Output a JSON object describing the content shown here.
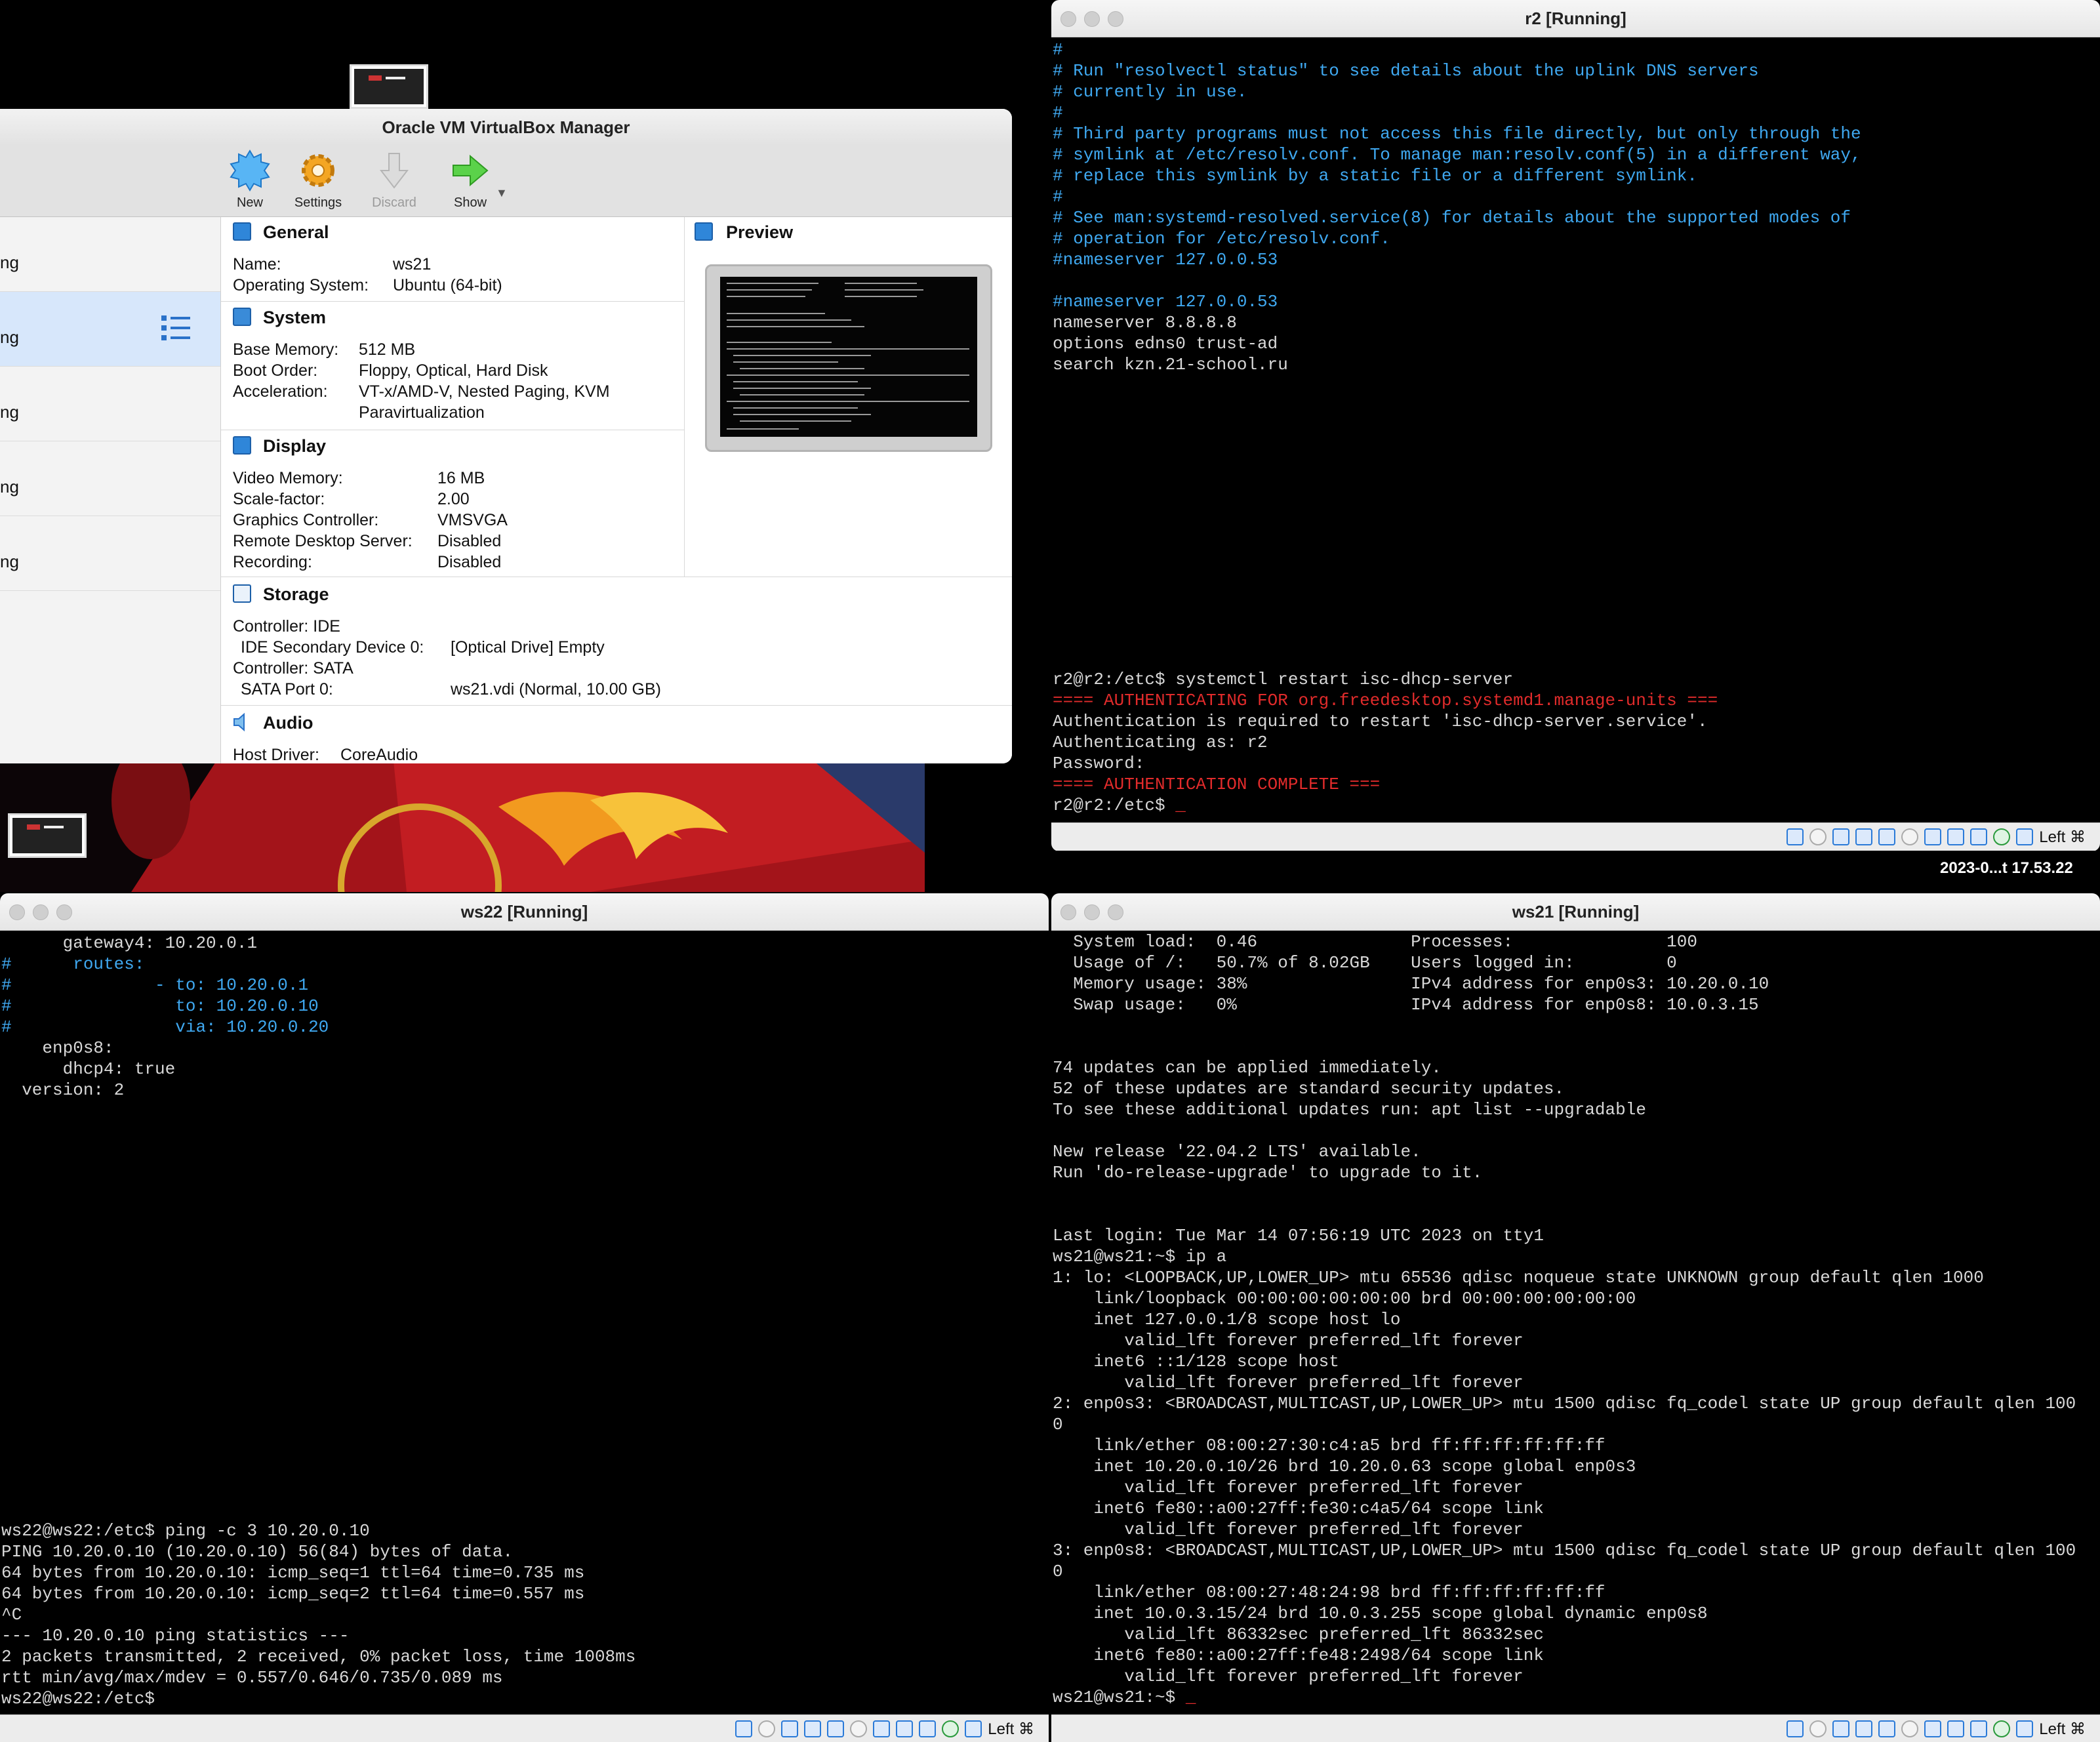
{
  "desktop": {
    "datetime": "2023-0...t 17.53.22"
  },
  "vbox": {
    "title": "Oracle VM VirtualBox Manager",
    "toolbar": {
      "new": "New",
      "settings": "Settings",
      "discard": "Discard",
      "show": "Show"
    },
    "vm_list": [
      "ng",
      "ng",
      "ng",
      "ng",
      "ng"
    ],
    "general": {
      "heading": "General",
      "name_label": "Name:",
      "name": "ws21",
      "os_label": "Operating System:",
      "os": "Ubuntu (64-bit)"
    },
    "system": {
      "heading": "System",
      "mem_label": "Base Memory:",
      "mem": "512 MB",
      "boot_label": "Boot Order:",
      "boot": "Floppy, Optical, Hard Disk",
      "accel_label": "Acceleration:",
      "accel1": "VT-x/AMD-V, Nested Paging, KVM",
      "accel2": "Paravirtualization"
    },
    "preview": {
      "heading": "Preview"
    },
    "display": {
      "heading": "Display",
      "vmem_label": "Video Memory:",
      "vmem": "16 MB",
      "scale_label": "Scale-factor:",
      "scale": "2.00",
      "gc_label": "Graphics Controller:",
      "gc": "VMSVGA",
      "rds_label": "Remote Desktop Server:",
      "rds": "Disabled",
      "rec_label": "Recording:",
      "rec": "Disabled"
    },
    "storage": {
      "heading": "Storage",
      "ctrl_ide": "Controller: IDE",
      "ide_dev_label": "IDE Secondary Device 0:",
      "ide_dev": "[Optical Drive] Empty",
      "ctrl_sata": "Controller: SATA",
      "sata_label": "SATA Port 0:",
      "sata": "ws21.vdi (Normal, 10.00 GB)"
    },
    "audio": {
      "heading": "Audio",
      "driver_label": "Host Driver:",
      "driver": "CoreAudio"
    }
  },
  "r2": {
    "title": "r2 [Running]",
    "status_key": "Left ⌘",
    "lines": [
      {
        "t": "#",
        "c": "blue"
      },
      {
        "t": "# Run \"resolvectl status\" to see details about the uplink DNS servers",
        "c": "blue"
      },
      {
        "t": "# currently in use.",
        "c": "blue"
      },
      {
        "t": "#",
        "c": "blue"
      },
      {
        "t": "# Third party programs must not access this file directly, but only through the",
        "c": "blue"
      },
      {
        "t": "# symlink at /etc/resolv.conf. To manage man:resolv.conf(5) in a different way,",
        "c": "blue"
      },
      {
        "t": "# replace this symlink by a static file or a different symlink.",
        "c": "blue"
      },
      {
        "t": "#",
        "c": "blue"
      },
      {
        "t": "# See man:systemd-resolved.service(8) for details about the supported modes of",
        "c": "blue"
      },
      {
        "t": "# operation for /etc/resolv.conf.",
        "c": "blue"
      },
      {
        "t": "#nameserver 127.0.0.53",
        "c": "blue"
      },
      {
        "t": "",
        "c": ""
      },
      {
        "t": "#nameserver 127.0.0.53",
        "c": "blue"
      },
      {
        "t": "nameserver 8.8.8.8",
        "c": ""
      },
      {
        "t": "options edns0 trust-ad",
        "c": ""
      },
      {
        "t": "search kzn.21-school.ru",
        "c": ""
      },
      {
        "t": "",
        "c": ""
      },
      {
        "t": "",
        "c": ""
      },
      {
        "t": "",
        "c": ""
      },
      {
        "t": "",
        "c": ""
      },
      {
        "t": "",
        "c": ""
      },
      {
        "t": "",
        "c": ""
      },
      {
        "t": "",
        "c": ""
      },
      {
        "t": "",
        "c": ""
      },
      {
        "t": "",
        "c": ""
      },
      {
        "t": "",
        "c": ""
      },
      {
        "t": "",
        "c": ""
      },
      {
        "t": "",
        "c": ""
      },
      {
        "t": "",
        "c": ""
      },
      {
        "t": "",
        "c": ""
      },
      {
        "t": "r2@r2:/etc$ systemctl restart isc-dhcp-server",
        "c": ""
      },
      {
        "t": "==== AUTHENTICATING FOR org.freedesktop.systemd1.manage-units ===",
        "c": "red"
      },
      {
        "t": "Authentication is required to restart 'isc-dhcp-server.service'.",
        "c": ""
      },
      {
        "t": "Authenticating as: r2",
        "c": ""
      },
      {
        "t": "Password:",
        "c": ""
      },
      {
        "t": "==== AUTHENTICATION COMPLETE ===",
        "c": "red"
      },
      {
        "t": "r2@r2:/etc$ ",
        "c": "",
        "cursor": "_"
      }
    ]
  },
  "ws22": {
    "title": "ws22 [Running]",
    "status_key": "Left ⌘",
    "lines": [
      {
        "t": "      gateway4: 10.20.0.1",
        "c": ""
      },
      {
        "t": "#      routes:",
        "c": "blue"
      },
      {
        "t": "#              - to: 10.20.0.1",
        "c": "blue"
      },
      {
        "t": "#                to: 10.20.0.10",
        "c": "blue"
      },
      {
        "t": "#                via: 10.20.0.20",
        "c": "blue"
      },
      {
        "t": "    enp0s8:",
        "c": ""
      },
      {
        "t": "      dhcp4: true",
        "c": ""
      },
      {
        "t": "  version: 2",
        "c": ""
      },
      {
        "t": "",
        "c": ""
      },
      {
        "t": "",
        "c": ""
      },
      {
        "t": "",
        "c": ""
      },
      {
        "t": "",
        "c": ""
      },
      {
        "t": "",
        "c": ""
      },
      {
        "t": "",
        "c": ""
      },
      {
        "t": "",
        "c": ""
      },
      {
        "t": "",
        "c": ""
      },
      {
        "t": "",
        "c": ""
      },
      {
        "t": "",
        "c": ""
      },
      {
        "t": "",
        "c": ""
      },
      {
        "t": "",
        "c": ""
      },
      {
        "t": "",
        "c": ""
      },
      {
        "t": "",
        "c": ""
      },
      {
        "t": "",
        "c": ""
      },
      {
        "t": "",
        "c": ""
      },
      {
        "t": "",
        "c": ""
      },
      {
        "t": "",
        "c": ""
      },
      {
        "t": "",
        "c": ""
      },
      {
        "t": "",
        "c": ""
      },
      {
        "t": "ws22@ws22:/etc$ ping -c 3 10.20.0.10",
        "c": ""
      },
      {
        "t": "PING 10.20.0.10 (10.20.0.10) 56(84) bytes of data.",
        "c": ""
      },
      {
        "t": "64 bytes from 10.20.0.10: icmp_seq=1 ttl=64 time=0.735 ms",
        "c": ""
      },
      {
        "t": "64 bytes from 10.20.0.10: icmp_seq=2 ttl=64 time=0.557 ms",
        "c": ""
      },
      {
        "t": "^C",
        "c": ""
      },
      {
        "t": "--- 10.20.0.10 ping statistics ---",
        "c": ""
      },
      {
        "t": "2 packets transmitted, 2 received, 0% packet loss, time 1008ms",
        "c": ""
      },
      {
        "t": "rtt min/avg/max/mdev = 0.557/0.646/0.735/0.089 ms",
        "c": ""
      },
      {
        "t": "ws22@ws22:/etc$",
        "c": ""
      }
    ]
  },
  "ws21": {
    "title": "ws21 [Running]",
    "status_key": "Left ⌘",
    "lines": [
      {
        "t": "  System load:  0.46               Processes:               100",
        "c": ""
      },
      {
        "t": "  Usage of /:   50.7% of 8.02GB    Users logged in:         0",
        "c": ""
      },
      {
        "t": "  Memory usage: 38%                IPv4 address for enp0s3: 10.20.0.10",
        "c": ""
      },
      {
        "t": "  Swap usage:   0%                 IPv4 address for enp0s8: 10.0.3.15",
        "c": ""
      },
      {
        "t": "",
        "c": ""
      },
      {
        "t": "",
        "c": ""
      },
      {
        "t": "74 updates can be applied immediately.",
        "c": ""
      },
      {
        "t": "52 of these updates are standard security updates.",
        "c": ""
      },
      {
        "t": "To see these additional updates run: apt list --upgradable",
        "c": ""
      },
      {
        "t": "",
        "c": ""
      },
      {
        "t": "New release '22.04.2 LTS' available.",
        "c": ""
      },
      {
        "t": "Run 'do-release-upgrade' to upgrade to it.",
        "c": ""
      },
      {
        "t": "",
        "c": ""
      },
      {
        "t": "",
        "c": ""
      },
      {
        "t": "Last login: Tue Mar 14 07:56:19 UTC 2023 on tty1",
        "c": ""
      },
      {
        "t": "ws21@ws21:~$ ip a",
        "c": ""
      },
      {
        "t": "1: lo: <LOOPBACK,UP,LOWER_UP> mtu 65536 qdisc noqueue state UNKNOWN group default qlen 1000",
        "c": ""
      },
      {
        "t": "    link/loopback 00:00:00:00:00:00 brd 00:00:00:00:00:00",
        "c": ""
      },
      {
        "t": "    inet 127.0.0.1/8 scope host lo",
        "c": ""
      },
      {
        "t": "       valid_lft forever preferred_lft forever",
        "c": ""
      },
      {
        "t": "    inet6 ::1/128 scope host",
        "c": ""
      },
      {
        "t": "       valid_lft forever preferred_lft forever",
        "c": ""
      },
      {
        "t": "2: enp0s3: <BROADCAST,MULTICAST,UP,LOWER_UP> mtu 1500 qdisc fq_codel state UP group default qlen 100",
        "c": ""
      },
      {
        "t": "0",
        "c": ""
      },
      {
        "t": "    link/ether 08:00:27:30:c4:a5 brd ff:ff:ff:ff:ff:ff",
        "c": ""
      },
      {
        "t": "    inet 10.20.0.10/26 brd 10.20.0.63 scope global enp0s3",
        "c": ""
      },
      {
        "t": "       valid_lft forever preferred_lft forever",
        "c": ""
      },
      {
        "t": "    inet6 fe80::a00:27ff:fe30:c4a5/64 scope link",
        "c": ""
      },
      {
        "t": "       valid_lft forever preferred_lft forever",
        "c": ""
      },
      {
        "t": "3: enp0s8: <BROADCAST,MULTICAST,UP,LOWER_UP> mtu 1500 qdisc fq_codel state UP group default qlen 100",
        "c": ""
      },
      {
        "t": "0",
        "c": ""
      },
      {
        "t": "    link/ether 08:00:27:48:24:98 brd ff:ff:ff:ff:ff:ff",
        "c": ""
      },
      {
        "t": "    inet 10.0.3.15/24 brd 10.0.3.255 scope global dynamic enp0s8",
        "c": ""
      },
      {
        "t": "       valid_lft 86332sec preferred_lft 86332sec",
        "c": ""
      },
      {
        "t": "    inet6 fe80::a00:27ff:fe48:2498/64 scope link",
        "c": ""
      },
      {
        "t": "       valid_lft forever preferred_lft forever",
        "c": ""
      },
      {
        "t": "ws21@ws21:~$ ",
        "c": "",
        "cursor": "_"
      }
    ]
  }
}
